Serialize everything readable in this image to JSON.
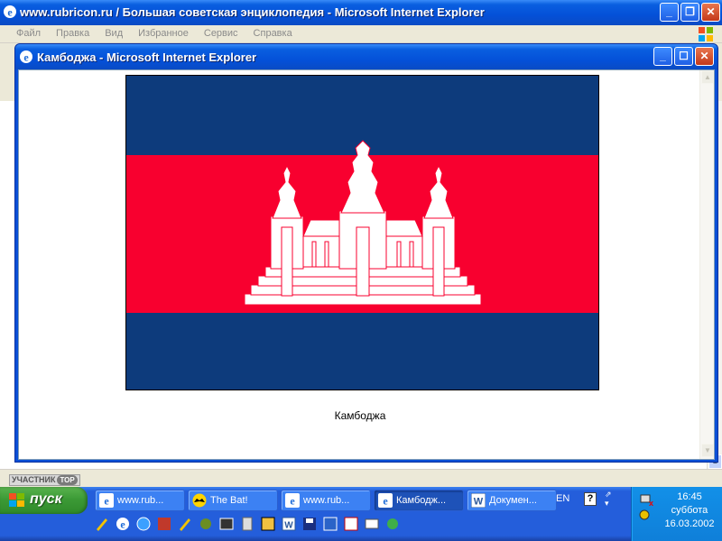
{
  "background_window": {
    "title": "www.rubricon.ru / Большая советская энциклопедия     - Microsoft Internet Explorer",
    "menu": [
      "Файл",
      "Правка",
      "Вид",
      "Избранное",
      "Сервис",
      "Справка"
    ]
  },
  "badge": {
    "label": "УЧАСТНИК",
    "tag": "TOP"
  },
  "popup": {
    "title": "Камбоджа - Microsoft Internet Explorer",
    "caption": "Камбоджа"
  },
  "flag_colors": {
    "blue": "#0d3b7c",
    "red": "#f8002f",
    "white": "#ffffff"
  },
  "taskbar": {
    "start_label": "пуск",
    "tasks": [
      {
        "label": "www.rub...",
        "icon": "ie-icon",
        "active": false
      },
      {
        "label": "The Bat!",
        "icon": "thebat-icon",
        "active": false
      },
      {
        "label": "www.rub...",
        "icon": "ie-icon",
        "active": false
      },
      {
        "label": "Камбодж...",
        "icon": "ie-icon",
        "active": true
      },
      {
        "label": "Докумен...",
        "icon": "word-icon",
        "active": false
      }
    ],
    "language": "EN",
    "help": "?",
    "clock": {
      "time": "16:45",
      "day": "суббота",
      "date": "16.03.2002"
    }
  }
}
